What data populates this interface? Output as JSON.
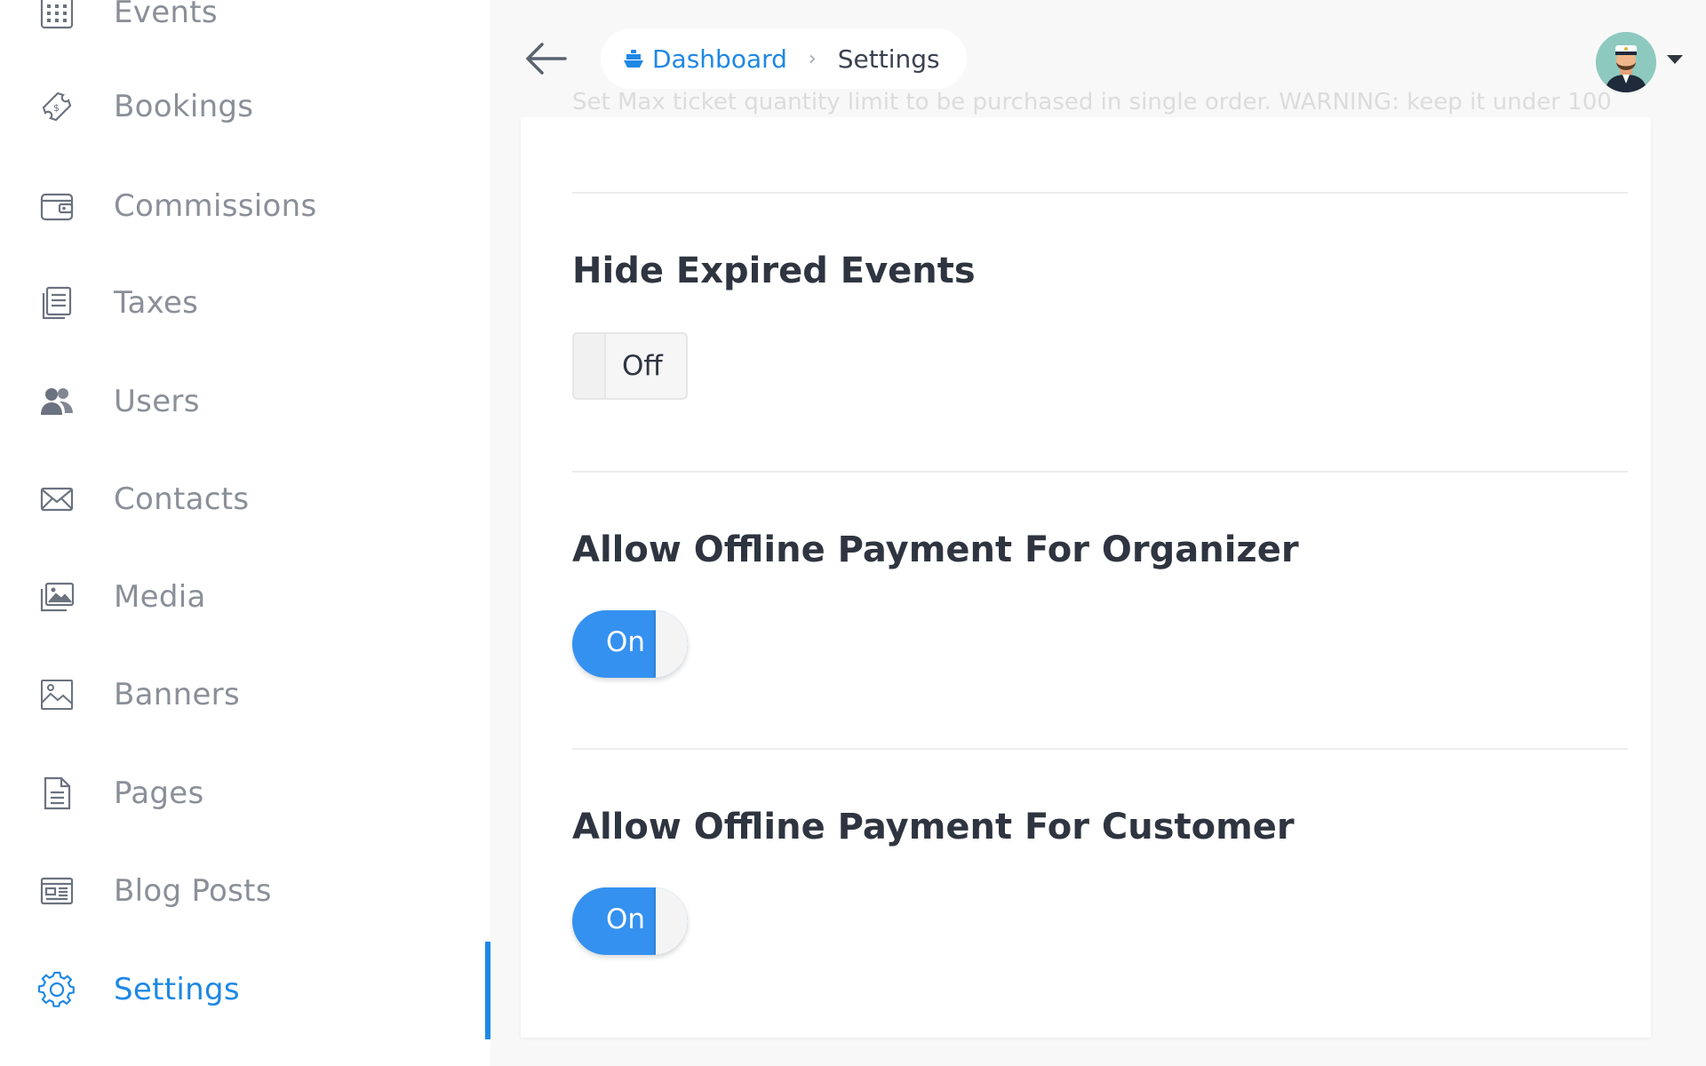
{
  "sidebar": {
    "items": [
      {
        "label": "Events",
        "icon": "calendar-grid-icon",
        "active": false
      },
      {
        "label": "Bookings",
        "icon": "ticket-icon",
        "active": false
      },
      {
        "label": "Commissions",
        "icon": "wallet-icon",
        "active": false
      },
      {
        "label": "Taxes",
        "icon": "documents-icon",
        "active": false
      },
      {
        "label": "Users",
        "icon": "users-icon",
        "active": false
      },
      {
        "label": "Contacts",
        "icon": "envelope-icon",
        "active": false
      },
      {
        "label": "Media",
        "icon": "images-icon",
        "active": false
      },
      {
        "label": "Banners",
        "icon": "picture-icon",
        "active": false
      },
      {
        "label": "Pages",
        "icon": "page-icon",
        "active": false
      },
      {
        "label": "Blog Posts",
        "icon": "newspaper-icon",
        "active": false
      },
      {
        "label": "Settings",
        "icon": "gear-icon",
        "active": true
      }
    ]
  },
  "header": {
    "breadcrumb": {
      "home": "Dashboard",
      "current": "Settings"
    },
    "ghost_help_text": "Set Max ticket quantity limit to be purchased in single order. WARNING: keep it under 100"
  },
  "settings": [
    {
      "title": "Hide Expired Events",
      "state": "Off"
    },
    {
      "title": "Allow Offline Payment For Organizer",
      "state": "On"
    },
    {
      "title": "Allow Offline Payment For Customer",
      "state": "On"
    }
  ],
  "colors": {
    "accent": "#1e88e5",
    "toggle_on": "#3591ef",
    "sidebar_text": "#8a8f98"
  }
}
